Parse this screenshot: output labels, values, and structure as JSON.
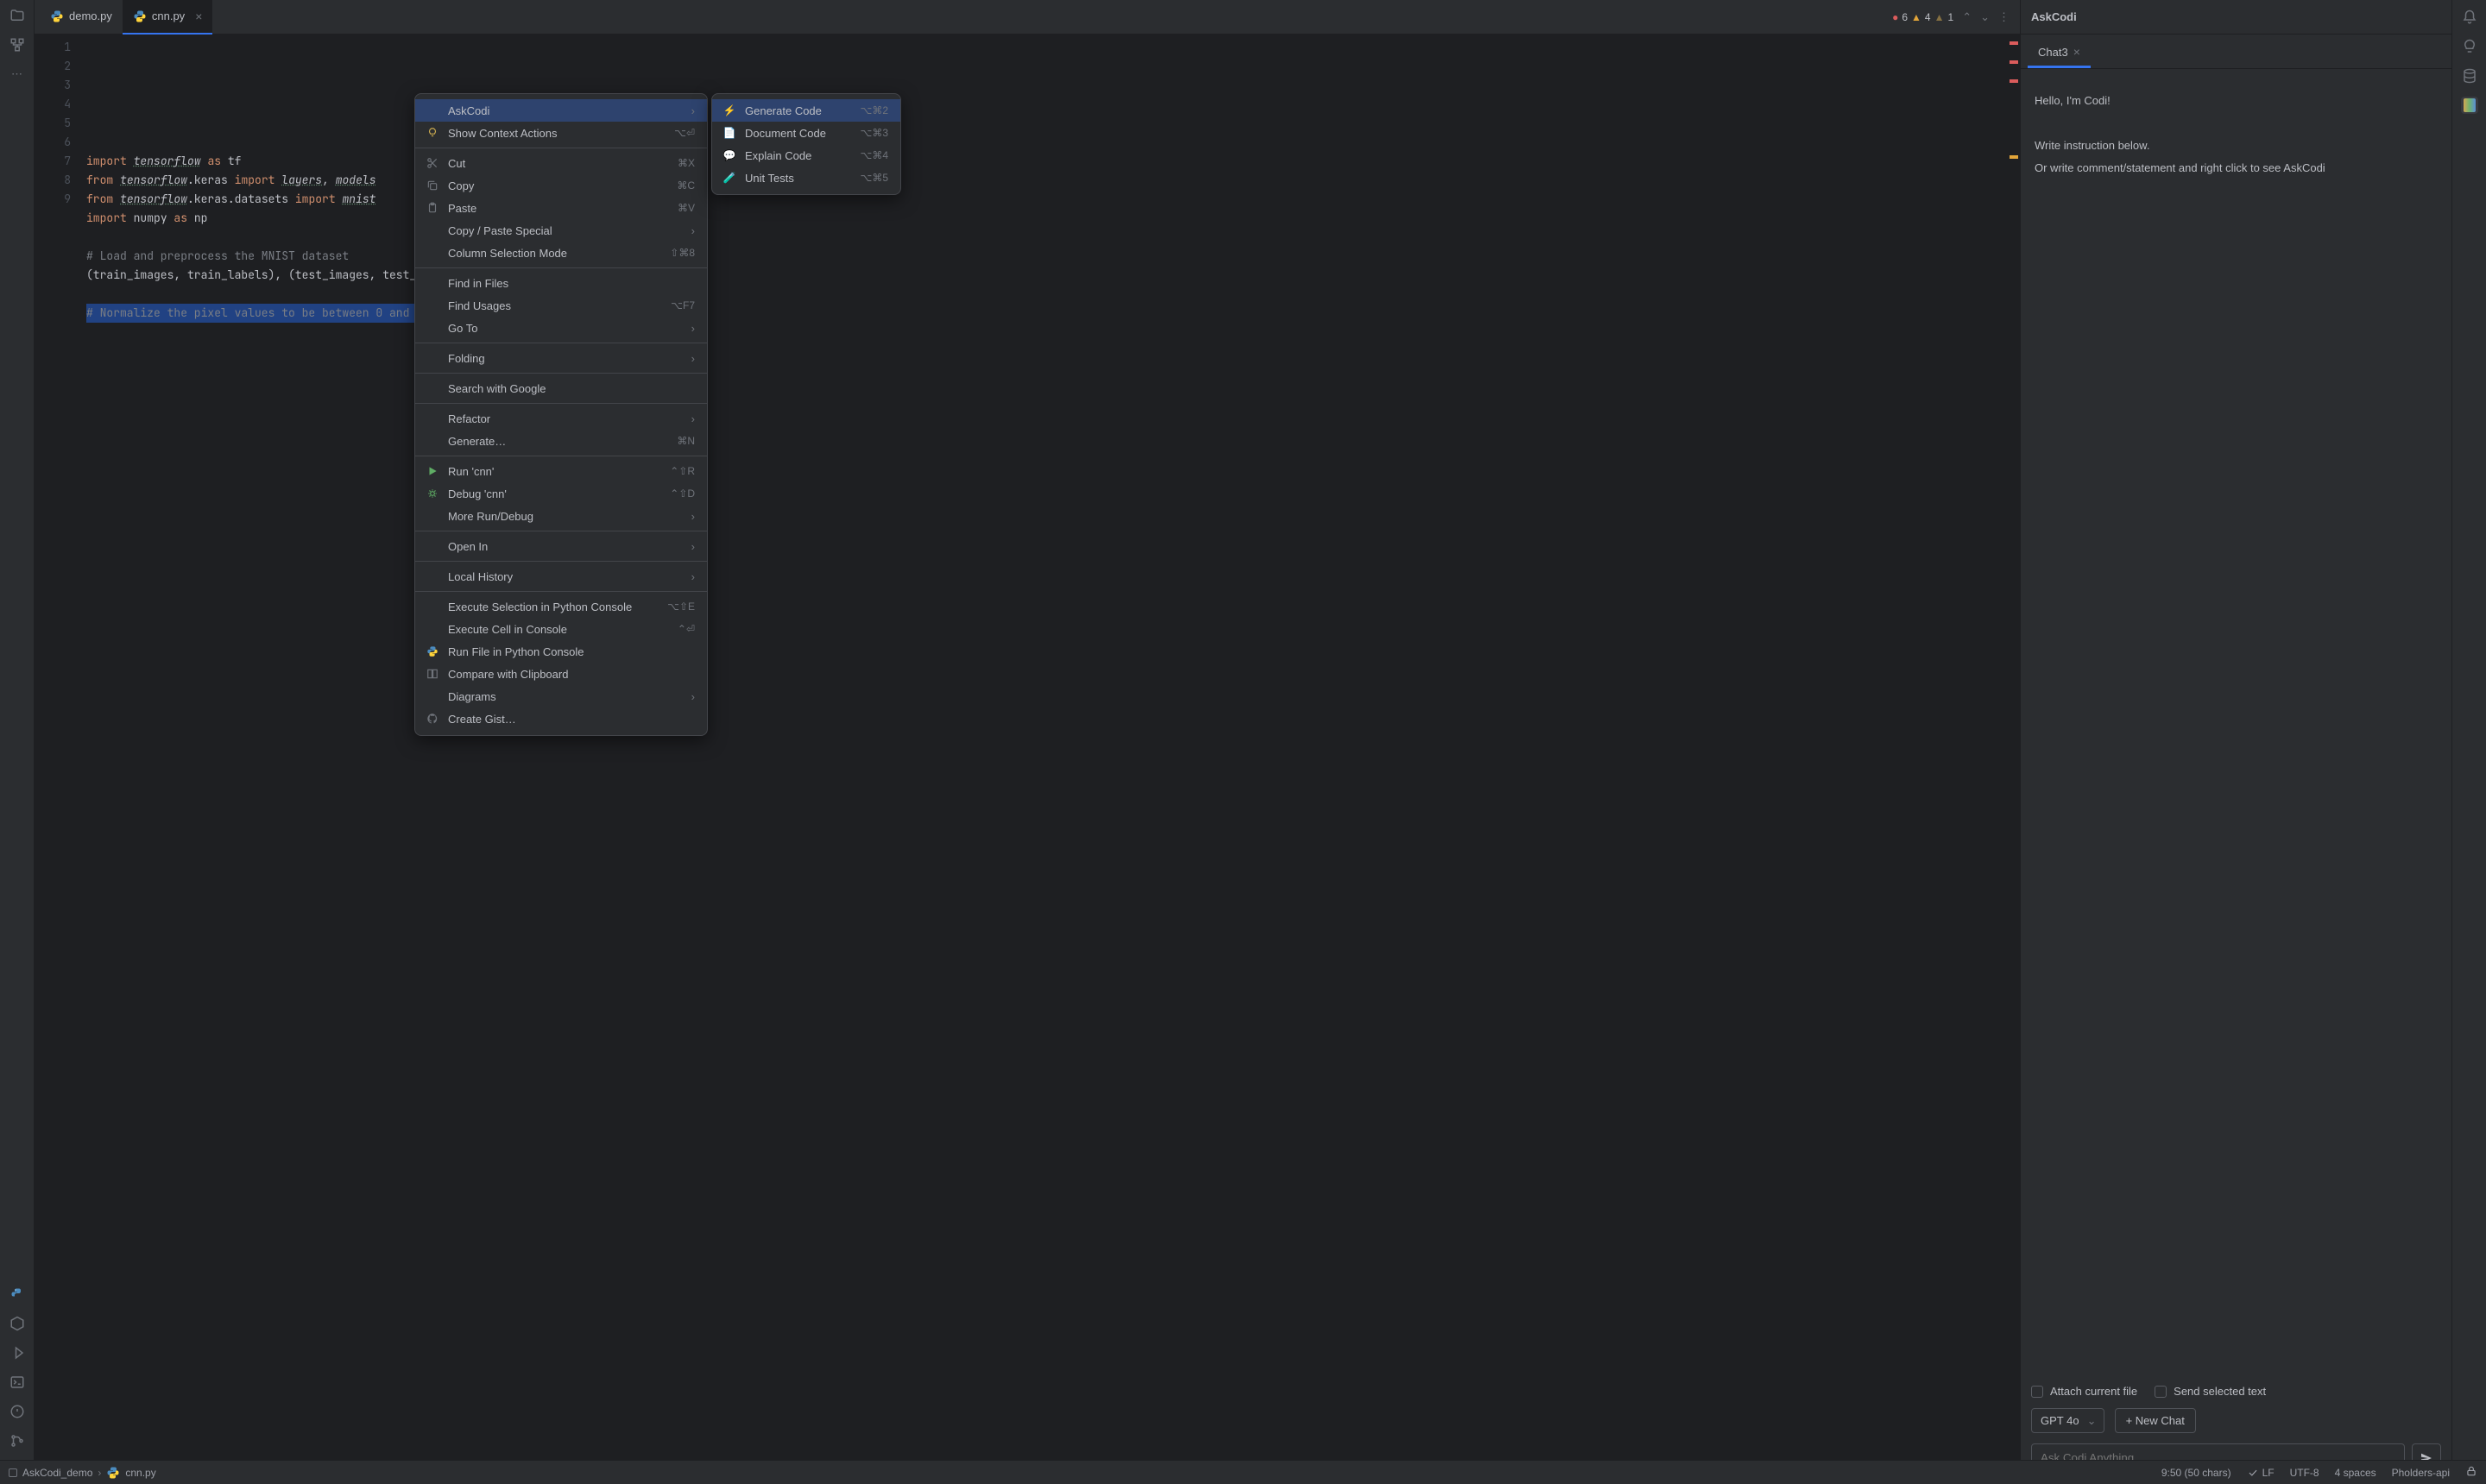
{
  "tabs": [
    {
      "label": "demo.py",
      "active": false
    },
    {
      "label": "cnn.py",
      "active": true
    }
  ],
  "inspections": {
    "errors": "6",
    "warnings": "4",
    "weak": "1"
  },
  "code": {
    "lines": [
      {
        "n": "1",
        "html": "<span class='kw'>import</span> <span class='mod'>tensorflow</span> <span class='kw'>as</span> tf"
      },
      {
        "n": "2",
        "html": "<span class='kw'>from</span> <span class='mod'>tensorflow</span>.keras <span class='kw'>import</span> <span class='mod'>layers</span>, <span class='mod'>models</span>"
      },
      {
        "n": "3",
        "html": "<span class='kw'>from</span> <span class='mod'>tensorflow</span>.keras.datasets <span class='kw'>import</span> <span class='mod'>mnist</span>"
      },
      {
        "n": "4",
        "html": "<span class='kw'>import</span> numpy <span class='kw'>as</span> np"
      },
      {
        "n": "5",
        "html": ""
      },
      {
        "n": "6",
        "html": "<span class='cm'># Load and preprocess the MNIST dataset</span>"
      },
      {
        "n": "7",
        "html": "(train_images, train_labels), (test_images, test_"
      },
      {
        "n": "8",
        "html": ""
      },
      {
        "n": "9",
        "html": "<span class='sel-line'><span class='cm'># Normalize the pixel values to be between 0 and </span></span>"
      }
    ]
  },
  "context_menu": [
    {
      "label": "AskCodi",
      "icon": "",
      "shortcut": "",
      "arrow": true,
      "hl": true
    },
    {
      "label": "Show Context Actions",
      "icon": "bulb",
      "shortcut": "⌥⏎"
    },
    {
      "sep": true
    },
    {
      "label": "Cut",
      "icon": "cut",
      "shortcut": "⌘X"
    },
    {
      "label": "Copy",
      "icon": "copy",
      "shortcut": "⌘C"
    },
    {
      "label": "Paste",
      "icon": "paste",
      "shortcut": "⌘V"
    },
    {
      "label": "Copy / Paste Special",
      "arrow": true
    },
    {
      "label": "Column Selection Mode",
      "shortcut": "⇧⌘8"
    },
    {
      "sep": true
    },
    {
      "label": "Find in Files"
    },
    {
      "label": "Find Usages",
      "shortcut": "⌥F7"
    },
    {
      "label": "Go To",
      "arrow": true
    },
    {
      "sep": true
    },
    {
      "label": "Folding",
      "arrow": true
    },
    {
      "sep": true
    },
    {
      "label": "Search with Google"
    },
    {
      "sep": true
    },
    {
      "label": "Refactor",
      "arrow": true
    },
    {
      "label": "Generate…",
      "shortcut": "⌘N"
    },
    {
      "sep": true
    },
    {
      "label": "Run 'cnn'",
      "icon": "run",
      "shortcut": "⌃⇧R"
    },
    {
      "label": "Debug 'cnn'",
      "icon": "debug",
      "shortcut": "⌃⇧D"
    },
    {
      "label": "More Run/Debug",
      "arrow": true
    },
    {
      "sep": true
    },
    {
      "label": "Open In",
      "arrow": true
    },
    {
      "sep": true
    },
    {
      "label": "Local History",
      "arrow": true
    },
    {
      "sep": true
    },
    {
      "label": "Execute Selection in Python Console",
      "shortcut": "⌥⇧E"
    },
    {
      "label": "Execute Cell in Console",
      "shortcut": "⌃⏎"
    },
    {
      "label": "Run File in Python Console",
      "icon": "python"
    },
    {
      "label": "Compare with Clipboard",
      "icon": "compare"
    },
    {
      "label": "Diagrams",
      "arrow": true
    },
    {
      "label": "Create Gist…",
      "icon": "github"
    }
  ],
  "submenu": [
    {
      "label": "Generate Code",
      "icon": "gen",
      "shortcut": "⌥⌘2",
      "hl": true
    },
    {
      "label": "Document Code",
      "icon": "doc",
      "shortcut": "⌥⌘3"
    },
    {
      "label": "Explain Code",
      "icon": "exp",
      "shortcut": "⌥⌘4"
    },
    {
      "label": "Unit Tests",
      "icon": "test",
      "shortcut": "⌥⌘5"
    }
  ],
  "right_panel": {
    "title": "AskCodi",
    "chat_tab": "Chat3",
    "messages": [
      "Hello, I'm Codi!",
      "",
      "Write instruction below.",
      "Or write comment/statement and right click to see AskCodi"
    ],
    "attach_label": "Attach current file",
    "send_sel_label": "Send selected text",
    "model": "GPT 4o",
    "new_chat": "+ New Chat",
    "placeholder": "Ask Codi Anything..."
  },
  "status": {
    "project": "AskCodi_demo",
    "file": "cnn.py",
    "pos": "9:50 (50 chars)",
    "le": "LF",
    "enc": "UTF-8",
    "indent": "4 spaces",
    "branch": "Pholders-api"
  }
}
